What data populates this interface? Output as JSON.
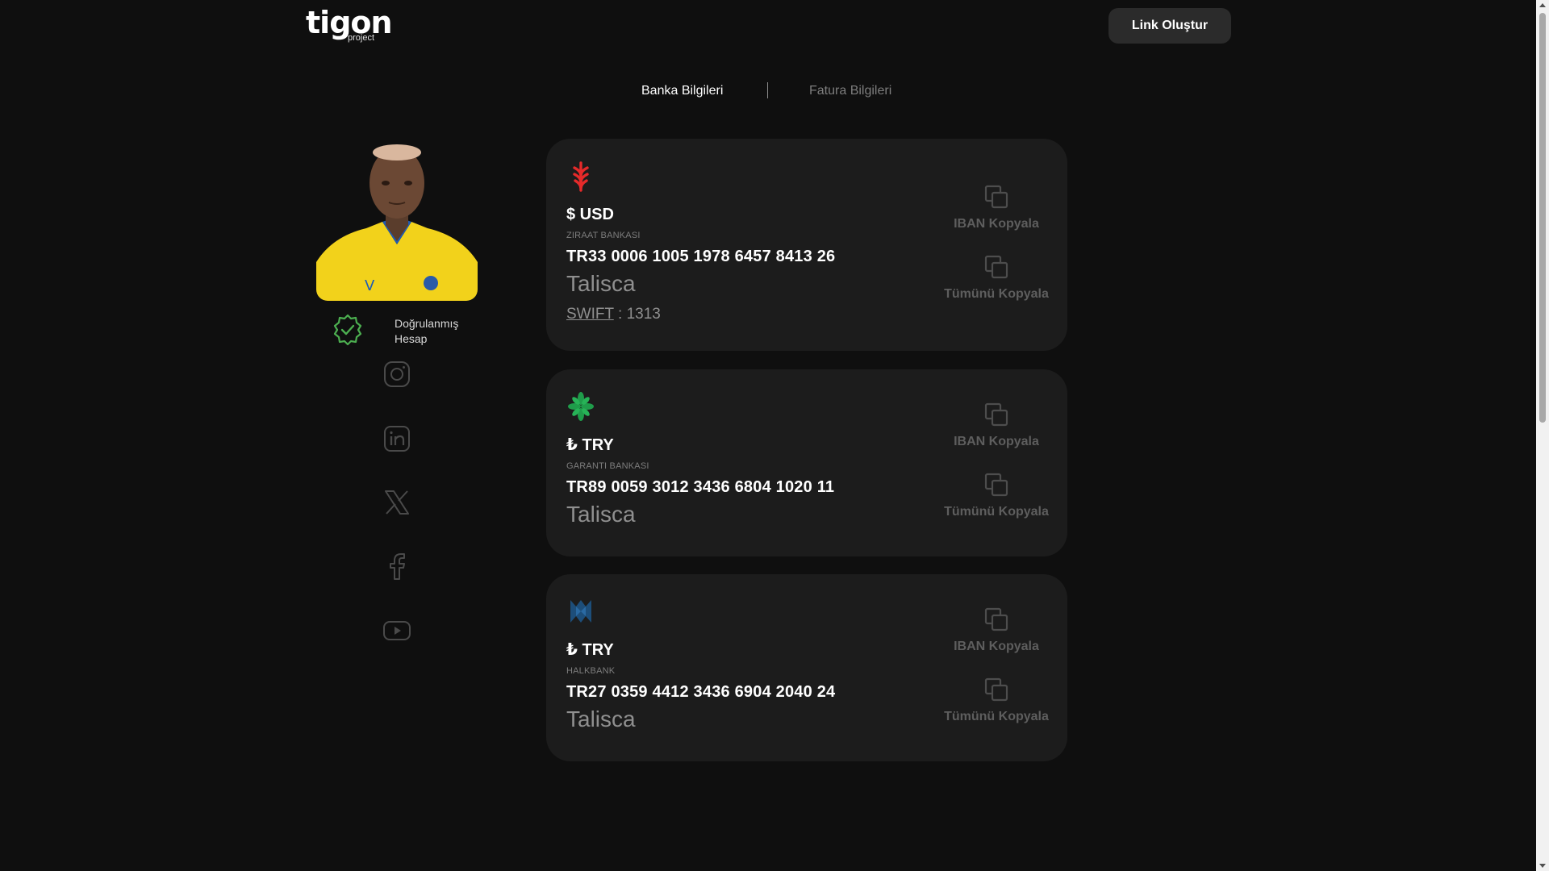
{
  "header": {
    "logo_text": "tigon",
    "logo_subtext": "project",
    "create_link_label": "Link Oluştur"
  },
  "tabs": [
    {
      "label": "Banka Bilgileri",
      "active": true
    },
    {
      "label": "Fatura Bilgileri",
      "active": false
    }
  ],
  "profile": {
    "verified_line1": "Doğrulanmış",
    "verified_line2": "Hesap",
    "verified_color": "#4caf50",
    "social_icons": [
      "instagram-icon",
      "linkedin-icon",
      "x-icon",
      "facebook-icon",
      "youtube-icon"
    ]
  },
  "accounts": [
    {
      "bank_icon": "ziraat-bank-logo",
      "bank_color": "#e52a2a",
      "currency": "$ USD",
      "bank_name": "ZIRAAT BANKASI",
      "iban": "TR33 0006 1005 1978 6457 8413 26",
      "holder": "Talisca",
      "swift_label": "SWIFT",
      "swift_value": " : 1313",
      "copy_iban_label": "IBAN Kopyala",
      "copy_all_label": "Tümünü Kopyala"
    },
    {
      "bank_icon": "garanti-bank-logo",
      "bank_color": "#1f9c4a",
      "currency": "₺ TRY",
      "bank_name": "GARANTI BANKASI",
      "iban": "TR89 0059 3012 3436 6804 1020 11",
      "holder": "Talisca",
      "copy_iban_label": "IBAN Kopyala",
      "copy_all_label": "Tümünü Kopyala"
    },
    {
      "bank_icon": "halkbank-logo",
      "bank_color": "#1d4e7a",
      "currency": "₺ TRY",
      "bank_name": "HALKBANK",
      "iban": "TR27 0359 4412 3436 6904 2040 24",
      "holder": "Talisca",
      "copy_iban_label": "IBAN Kopyala",
      "copy_all_label": "Tümünü Kopyala"
    }
  ]
}
